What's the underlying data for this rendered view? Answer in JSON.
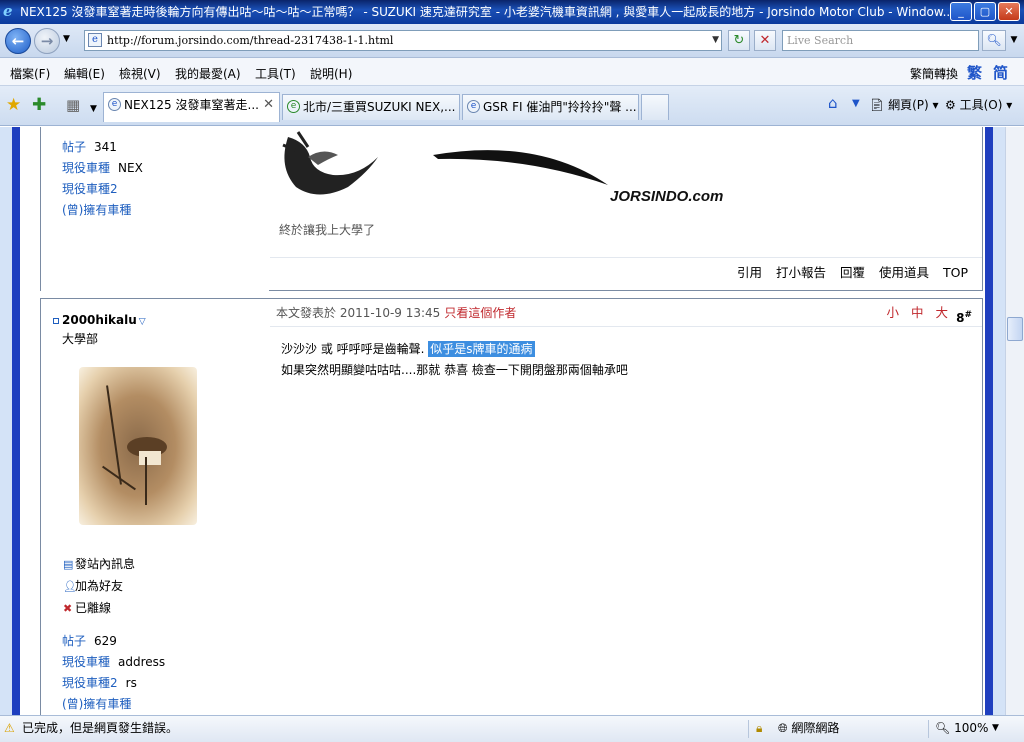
{
  "window": {
    "title": "NEX125 沒發車窒著走時後輪方向有傳出咕～咕～咕～正常嗎？ - SUZUKI 速克達研究室 - 小老婆汽機車資訊網 , 與愛車人一起成長的地方 - Jorsindo Motor Club - Window..."
  },
  "address": {
    "url": "http://forum.jorsindo.com/thread-2317438-1-1.html",
    "search_placeholder": "Live Search"
  },
  "menu": {
    "items": [
      "檔案(F)",
      "編輯(E)",
      "檢視(V)",
      "我的最愛(A)",
      "工具(T)",
      "說明(H)"
    ],
    "convert_label": "繁簡轉換",
    "trad_label": "繁",
    "simp_label": "简"
  },
  "tabs": [
    {
      "label": "NEX125 沒發車窒著走..."
    },
    {
      "label": "北市/三重買SUZUKI NEX,..."
    },
    {
      "label": "GSR FI 催油門\"拎拎拎\"聲 ..."
    }
  ],
  "tab_tools": {
    "page_label": "網頁(P)",
    "tools_label": "工具(O)"
  },
  "post1": {
    "stats": [
      {
        "label": "帖子",
        "value": "341"
      },
      {
        "label": "現役車種",
        "value": "NEX"
      },
      {
        "label": "現役車種2",
        "value": ""
      },
      {
        "label": "(曾)擁有車種",
        "value": ""
      }
    ],
    "signature_logo": "JORSINDO.com",
    "signature_text": "終於讓我上大學了",
    "actions": [
      "引用",
      "打小報告",
      "回覆",
      "使用道具",
      "TOP"
    ]
  },
  "post2": {
    "username": "2000hikalu",
    "group": "大學部",
    "links": [
      "發站內訊息",
      "加為好友",
      "已離線"
    ],
    "stats": [
      {
        "label": "帖子",
        "value": "629"
      },
      {
        "label": "現役車種",
        "value": "address"
      },
      {
        "label": "現役車種2",
        "value": "rs"
      },
      {
        "label": "(曾)擁有車種",
        "value": ""
      }
    ],
    "posted_prefix": "本文發表於 2011-10-9 13:45",
    "author_only": "只看這個作者",
    "font_sizes": "小 中 大",
    "floor": "8",
    "floor_mark": "#",
    "body_line1": "沙沙沙  或  呼呼呼是齒輪聲.",
    "body_highlight": "似乎是s牌車的通病",
    "body_line2": "如果突然明顯變咕咕咕....那就   恭喜 檢查一下開閉盤那兩個軸承吧"
  },
  "status": {
    "message": "已完成，但是網頁發生錯誤。",
    "zone": "網際網路",
    "zoom": "100%"
  },
  "colors": {
    "title_bar": "#0b3a9c",
    "frame_blue": "#1f3fbf",
    "link_red": "#c0282d",
    "highlight": "#3d8ee0"
  }
}
